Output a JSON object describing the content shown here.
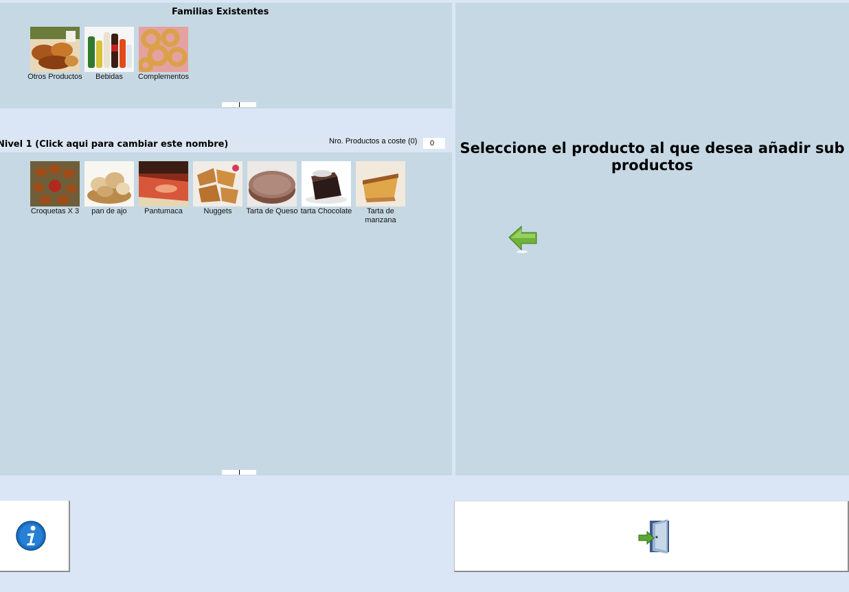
{
  "families": {
    "title": "Familias Existentes",
    "items": [
      {
        "label": "Otros Productos",
        "image": "pastries-photo"
      },
      {
        "label": "Bebidas",
        "image": "drink-bottles-photo"
      },
      {
        "label": "Complementos",
        "image": "onion-rings-photo"
      }
    ]
  },
  "level": {
    "title": "Nivel 1 (Click aqui para cambiar este nombre)",
    "cost_label": "Nro. Productos a coste (0)",
    "cost_value": "0",
    "items": [
      {
        "label": "Croquetas X 3",
        "image": "croquettes-photo"
      },
      {
        "label": "pan de ajo",
        "image": "bread-basket-photo"
      },
      {
        "label": "Pantumaca",
        "image": "tomato-bread-photo"
      },
      {
        "label": "Nuggets",
        "image": "nuggets-photo"
      },
      {
        "label": "Tarta de Queso",
        "image": "cheesecake-photo"
      },
      {
        "label": "tarta Chocolate",
        "image": "chocolate-cake-photo"
      },
      {
        "label": "Tarta de manzana",
        "image": "apple-tart-photo"
      }
    ]
  },
  "right_panel": {
    "instruction": "Seleccione el producto al que desea añadir sub productos",
    "arrow_icon": "green-left-arrow-icon"
  },
  "buttons": {
    "info_icon": "info-icon",
    "exit_icon": "exit-door-icon"
  },
  "colors": {
    "panel": "#c6d8e3",
    "background": "#dae6f5",
    "header_strip": "#dbe6f2",
    "arrow_green": "#6fb33a",
    "info_blue": "#1a6fc0"
  }
}
